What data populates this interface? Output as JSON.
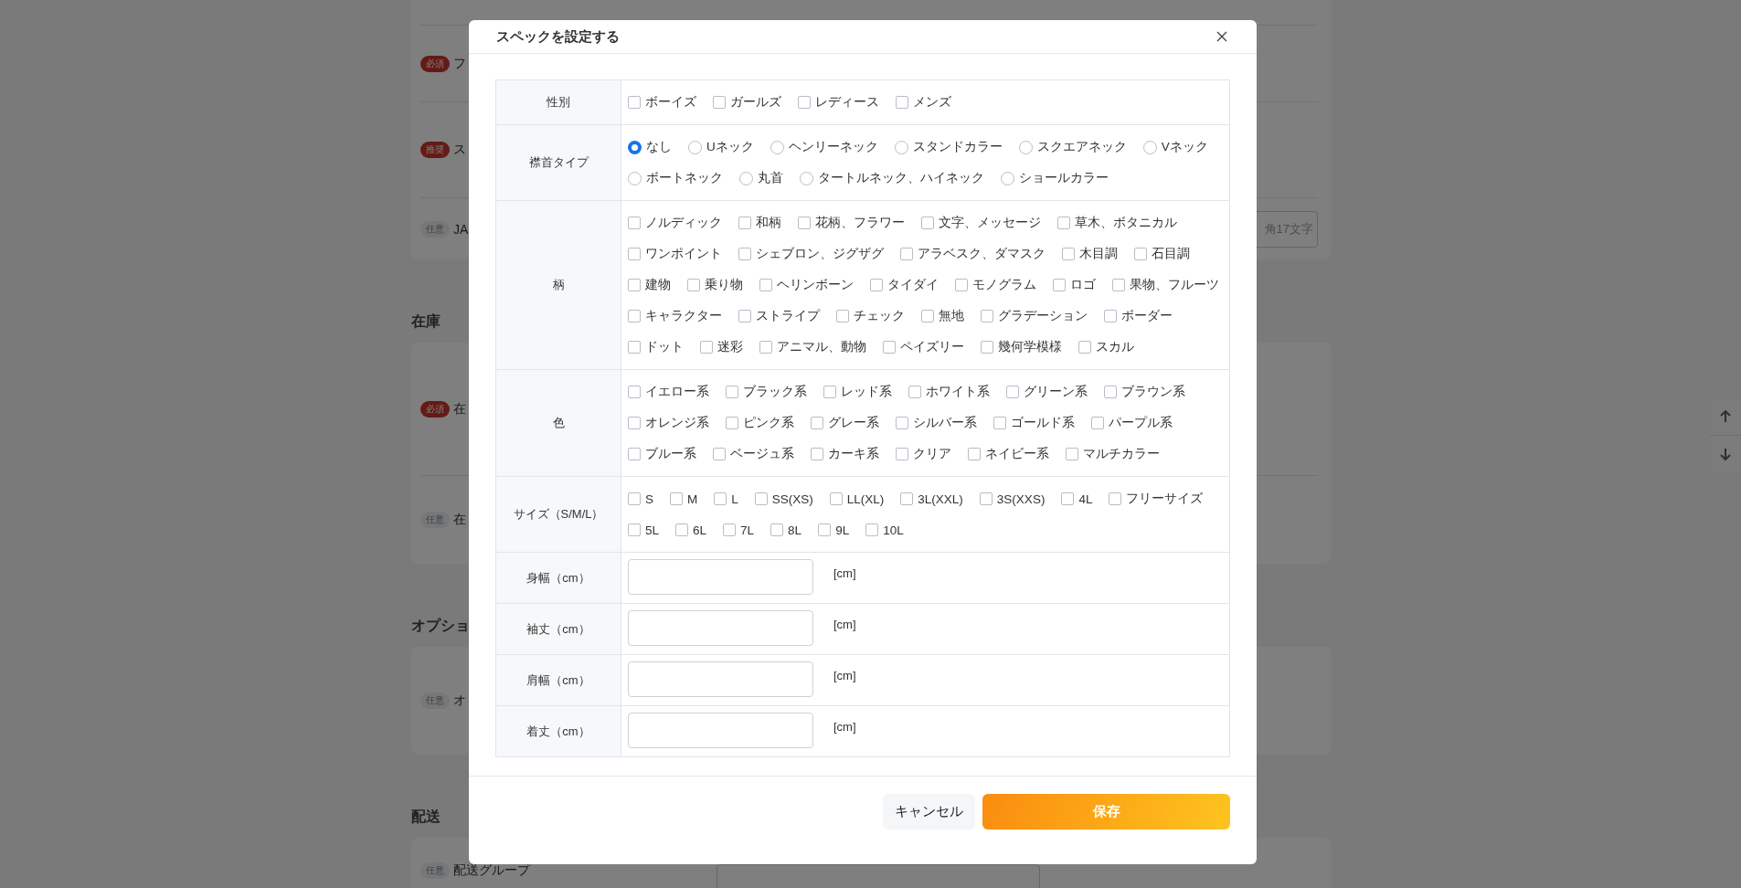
{
  "page": {
    "sections": [
      {
        "rows": [
          {
            "badge": {
              "label": "必須",
              "kind": "required"
            },
            "label": "フ",
            "kind": "plain"
          },
          {
            "badge": {
              "label": "推奨",
              "kind": "recommended"
            },
            "label": "ス",
            "kind": "plain"
          },
          {
            "badge": {
              "label": "任意",
              "kind": "optional"
            },
            "label": "JA",
            "kind": "input",
            "placeholder": "角17文字"
          }
        ]
      },
      {
        "title": "在庫",
        "rows": [
          {
            "badge": {
              "label": "必須",
              "kind": "required"
            },
            "label": "在",
            "kind": "plain"
          },
          {
            "badge": {
              "label": "任意",
              "kind": "optional"
            },
            "label": "在",
            "kind": "plain"
          }
        ]
      },
      {
        "title": "オプショ",
        "rows": [
          {
            "badge": {
              "label": "任意",
              "kind": "optional"
            },
            "label": "オ",
            "kind": "plain"
          }
        ]
      },
      {
        "title": "配送",
        "rows": [
          {
            "badge": {
              "label": "任意",
              "kind": "optional"
            },
            "label": "配送グループ",
            "kind": "select"
          }
        ]
      }
    ]
  },
  "dialog": {
    "title": "スペックを設定する",
    "spec_rows": [
      {
        "label": "性別",
        "kind": "checkboxes",
        "options": [
          {
            "label": "ボーイズ",
            "checked": false
          },
          {
            "label": "ガールズ",
            "checked": false
          },
          {
            "label": "レディース",
            "checked": false
          },
          {
            "label": "メンズ",
            "checked": false
          }
        ]
      },
      {
        "label": "襟首タイプ",
        "kind": "radios",
        "options": [
          {
            "label": "なし",
            "selected": true
          },
          {
            "label": "Uネック",
            "selected": false
          },
          {
            "label": "ヘンリーネック",
            "selected": false
          },
          {
            "label": "スタンドカラー",
            "selected": false
          },
          {
            "label": "スクエアネック",
            "selected": false
          },
          {
            "label": "Vネック",
            "selected": false
          },
          {
            "label": "ボートネック",
            "selected": false
          },
          {
            "label": "丸首",
            "selected": false
          },
          {
            "label": "タートルネック、ハイネック",
            "selected": false
          },
          {
            "label": "ショールカラー",
            "selected": false
          }
        ]
      },
      {
        "label": "柄",
        "kind": "checkboxes",
        "options": [
          {
            "label": "ノルディック",
            "checked": false
          },
          {
            "label": "和柄",
            "checked": false
          },
          {
            "label": "花柄、フラワー",
            "checked": false
          },
          {
            "label": "文字、メッセージ",
            "checked": false
          },
          {
            "label": "草木、ボタニカル",
            "checked": false
          },
          {
            "label": "ワンポイント",
            "checked": false
          },
          {
            "label": "シェブロン、ジグザグ",
            "checked": false
          },
          {
            "label": "アラベスク、ダマスク",
            "checked": false
          },
          {
            "label": "木目調",
            "checked": false
          },
          {
            "label": "石目調",
            "checked": false
          },
          {
            "label": "建物",
            "checked": false
          },
          {
            "label": "乗り物",
            "checked": false
          },
          {
            "label": "ヘリンボーン",
            "checked": false
          },
          {
            "label": "タイダイ",
            "checked": false
          },
          {
            "label": "モノグラム",
            "checked": false
          },
          {
            "label": "ロゴ",
            "checked": false
          },
          {
            "label": "果物、フルーツ",
            "checked": false
          },
          {
            "label": "キャラクター",
            "checked": false
          },
          {
            "label": "ストライプ",
            "checked": false
          },
          {
            "label": "チェック",
            "checked": false
          },
          {
            "label": "無地",
            "checked": false
          },
          {
            "label": "グラデーション",
            "checked": false
          },
          {
            "label": "ボーダー",
            "checked": false
          },
          {
            "label": "ドット",
            "checked": false
          },
          {
            "label": "迷彩",
            "checked": false
          },
          {
            "label": "アニマル、動物",
            "checked": false
          },
          {
            "label": "ペイズリー",
            "checked": false
          },
          {
            "label": "幾何学模様",
            "checked": false
          },
          {
            "label": "スカル",
            "checked": false
          }
        ]
      },
      {
        "label": "色",
        "kind": "checkboxes",
        "options": [
          {
            "label": "イエロー系",
            "checked": false
          },
          {
            "label": "ブラック系",
            "checked": false
          },
          {
            "label": "レッド系",
            "checked": false
          },
          {
            "label": "ホワイト系",
            "checked": false
          },
          {
            "label": "グリーン系",
            "checked": false
          },
          {
            "label": "ブラウン系",
            "checked": false
          },
          {
            "label": "オレンジ系",
            "checked": false
          },
          {
            "label": "ピンク系",
            "checked": false
          },
          {
            "label": "グレー系",
            "checked": false
          },
          {
            "label": "シルバー系",
            "checked": false
          },
          {
            "label": "ゴールド系",
            "checked": false
          },
          {
            "label": "パープル系",
            "checked": false
          },
          {
            "label": "ブルー系",
            "checked": false
          },
          {
            "label": "ベージュ系",
            "checked": false
          },
          {
            "label": "カーキ系",
            "checked": false
          },
          {
            "label": "クリア",
            "checked": false
          },
          {
            "label": "ネイビー系",
            "checked": false
          },
          {
            "label": "マルチカラー",
            "checked": false
          }
        ]
      },
      {
        "label": "サイズ（S/M/L）",
        "kind": "checkboxes",
        "options": [
          {
            "label": "S",
            "checked": false
          },
          {
            "label": "M",
            "checked": false
          },
          {
            "label": "L",
            "checked": false
          },
          {
            "label": "SS(XS)",
            "checked": false
          },
          {
            "label": "LL(XL)",
            "checked": false
          },
          {
            "label": "3L(XXL)",
            "checked": false
          },
          {
            "label": "3S(XXS)",
            "checked": false
          },
          {
            "label": "4L",
            "checked": false
          },
          {
            "label": "フリーサイズ",
            "checked": false
          },
          {
            "label": "5L",
            "checked": false
          },
          {
            "label": "6L",
            "checked": false
          },
          {
            "label": "7L",
            "checked": false
          },
          {
            "label": "8L",
            "checked": false
          },
          {
            "label": "9L",
            "checked": false
          },
          {
            "label": "10L",
            "checked": false
          }
        ]
      },
      {
        "label": "身幅（cm）",
        "kind": "number",
        "unit": "[cm]"
      },
      {
        "label": "袖丈（cm）",
        "kind": "number",
        "unit": "[cm]"
      },
      {
        "label": "肩幅（cm）",
        "kind": "number",
        "unit": "[cm]"
      },
      {
        "label": "着丈（cm）",
        "kind": "number",
        "unit": "[cm]"
      }
    ],
    "buttons": [
      {
        "label": "キャンセル",
        "kind": "secondary"
      },
      {
        "label": "保存",
        "kind": "primary"
      }
    ]
  }
}
